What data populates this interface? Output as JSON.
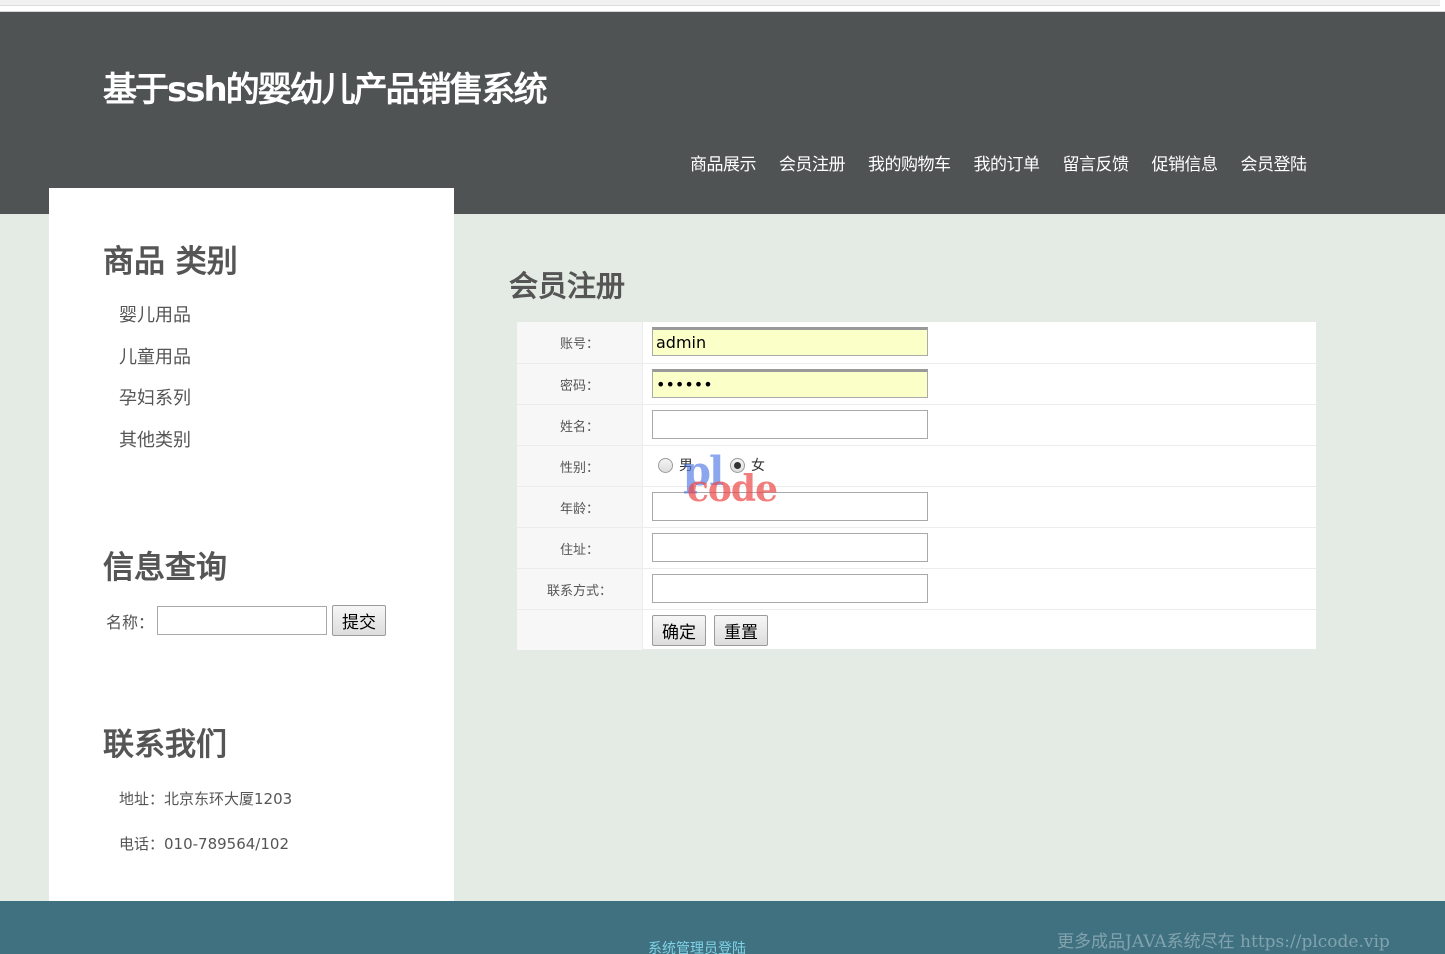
{
  "site": {
    "title": "基于ssh的婴幼儿产品销售系统"
  },
  "nav": [
    "商品展示",
    "会员注册",
    "我的购物车",
    "我的订单",
    "留言反馈",
    "促销信息",
    "会员登陆"
  ],
  "sidebar": {
    "categories_title": "商品 类别",
    "categories": [
      "婴儿用品",
      "儿童用品",
      "孕妇系列",
      "其他类别"
    ],
    "query_title": "信息查询",
    "query_label": "名称：",
    "query_value": "",
    "query_button": "提交",
    "contact_title": "联系我们",
    "address": "地址：北京东环大厦1203",
    "phone": "电话：010-789564/102"
  },
  "form": {
    "title": "会员注册",
    "account_label": "账号：",
    "account_value": "admin",
    "password_label": "密码：",
    "password_value": "••••••",
    "name_label": "姓名：",
    "gender_label": "性别：",
    "gender_male": "男",
    "gender_female": "女",
    "gender_selected": "女",
    "age_label": "年龄：",
    "address_label": "住址：",
    "contact_label": "联系方式：",
    "submit": "确定",
    "reset": "重置"
  },
  "watermark": {
    "pl": "pl",
    "code": "code"
  },
  "footer": {
    "admin_link": "系统管理员登陆",
    "watermark_text": "更多成品JAVA系统尽在 https://plcode.vip"
  }
}
